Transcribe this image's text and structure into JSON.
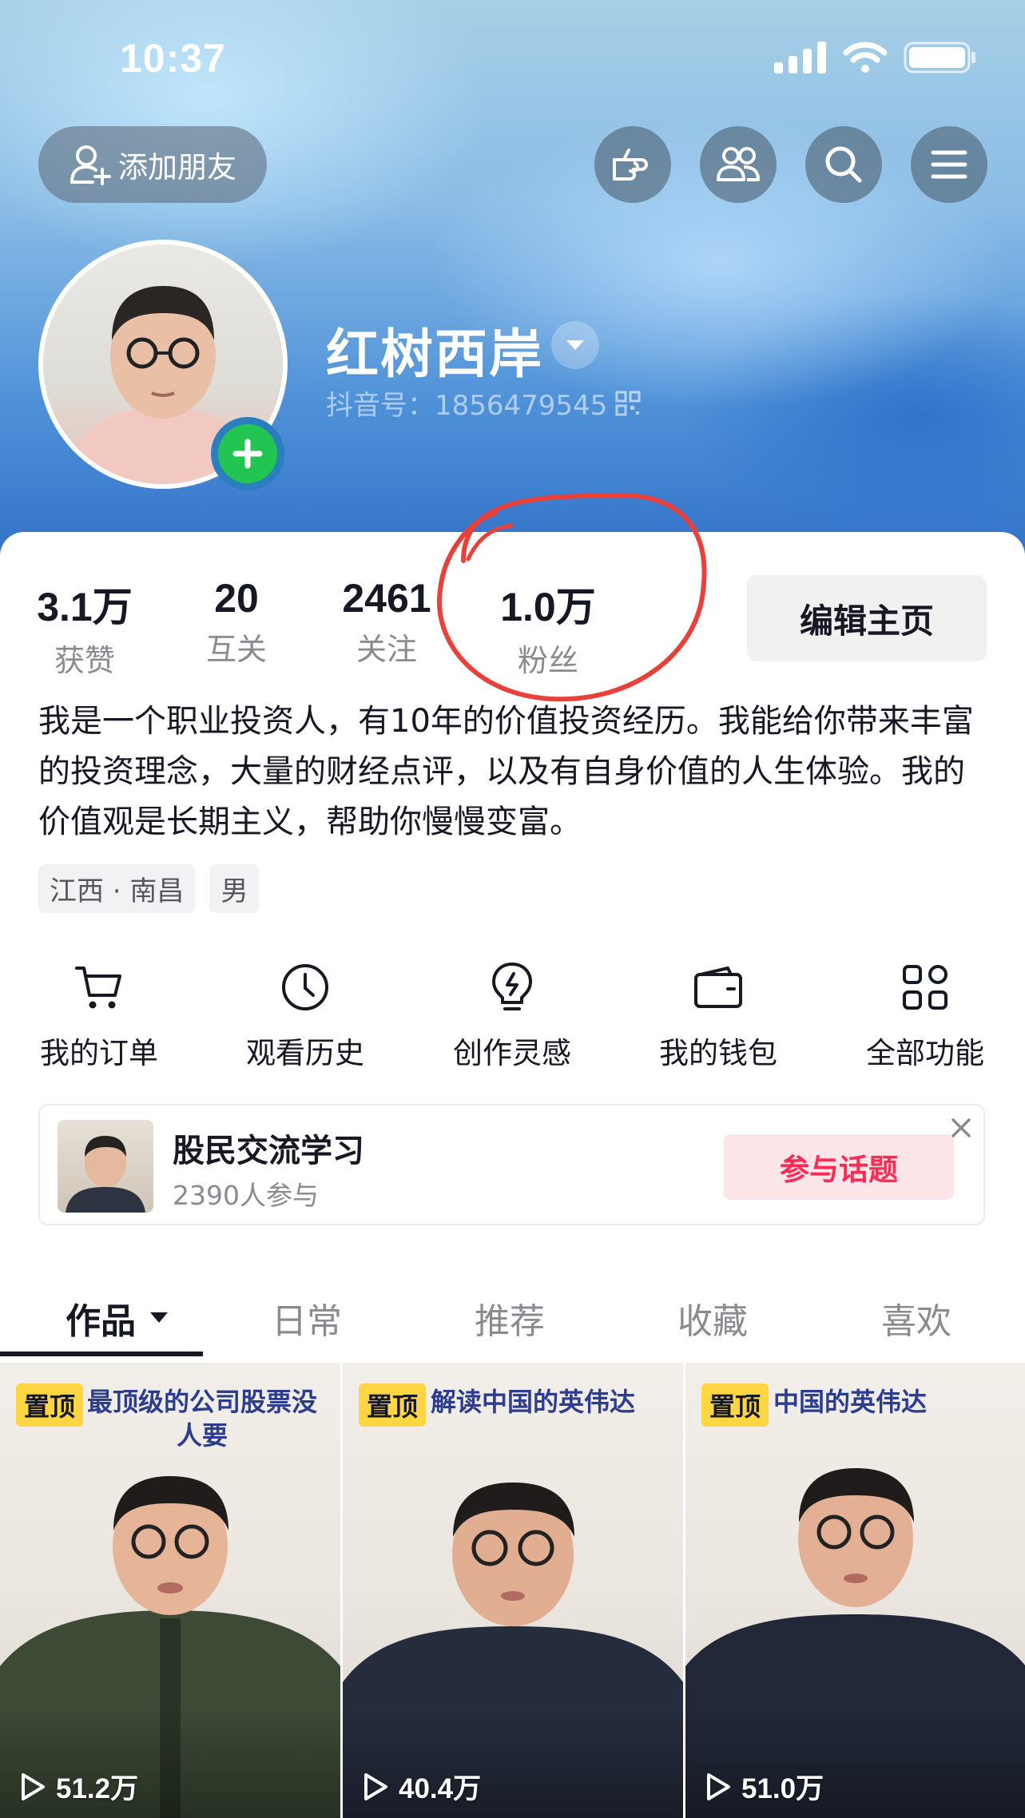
{
  "status_bar": {
    "time": "10:37"
  },
  "header": {
    "add_friend_label": "添加朋友",
    "profile_name": "红树西岸",
    "douyin_id": "抖音号：1856479545"
  },
  "stats": [
    {
      "value": "3.1万",
      "label": "获赞"
    },
    {
      "value": "20",
      "label": "互关"
    },
    {
      "value": "2461",
      "label": "关注"
    },
    {
      "value": "1.0万",
      "label": "粉丝"
    }
  ],
  "edit_profile_label": "编辑主页",
  "bio": "我是一个职业投资人，有10年的价值投资经历。我能给你带来丰富的投资理念，大量的财经点评，以及有自身价值的人生体验。我的价值观是长期主义，帮助你慢慢变富。",
  "tags": [
    "江西 · 南昌",
    "男"
  ],
  "quick_actions": [
    {
      "label": "我的订单",
      "icon": "cart-icon"
    },
    {
      "label": "观看历史",
      "icon": "clock-icon"
    },
    {
      "label": "创作灵感",
      "icon": "lightbulb-icon"
    },
    {
      "label": "我的钱包",
      "icon": "wallet-icon"
    },
    {
      "label": "全部功能",
      "icon": "grid-icon"
    }
  ],
  "topic": {
    "title": "股民交流学习",
    "participants": "2390人参与",
    "join_label": "参与话题"
  },
  "tabs": [
    "作品",
    "日常",
    "推荐",
    "收藏",
    "喜欢"
  ],
  "videos": [
    {
      "pin": "置顶",
      "caption": "最顶级的公司股票没人要",
      "plays": "51.2万"
    },
    {
      "pin": "置顶",
      "caption": "解读中国的英伟达",
      "plays": "40.4万"
    },
    {
      "pin": "置顶",
      "caption": "中国的英伟达",
      "plays": "51.0万"
    }
  ],
  "colors": {
    "accent_red": "#fe2c55",
    "pin_yellow": "#fed641",
    "annotation_red": "#e8403a"
  }
}
